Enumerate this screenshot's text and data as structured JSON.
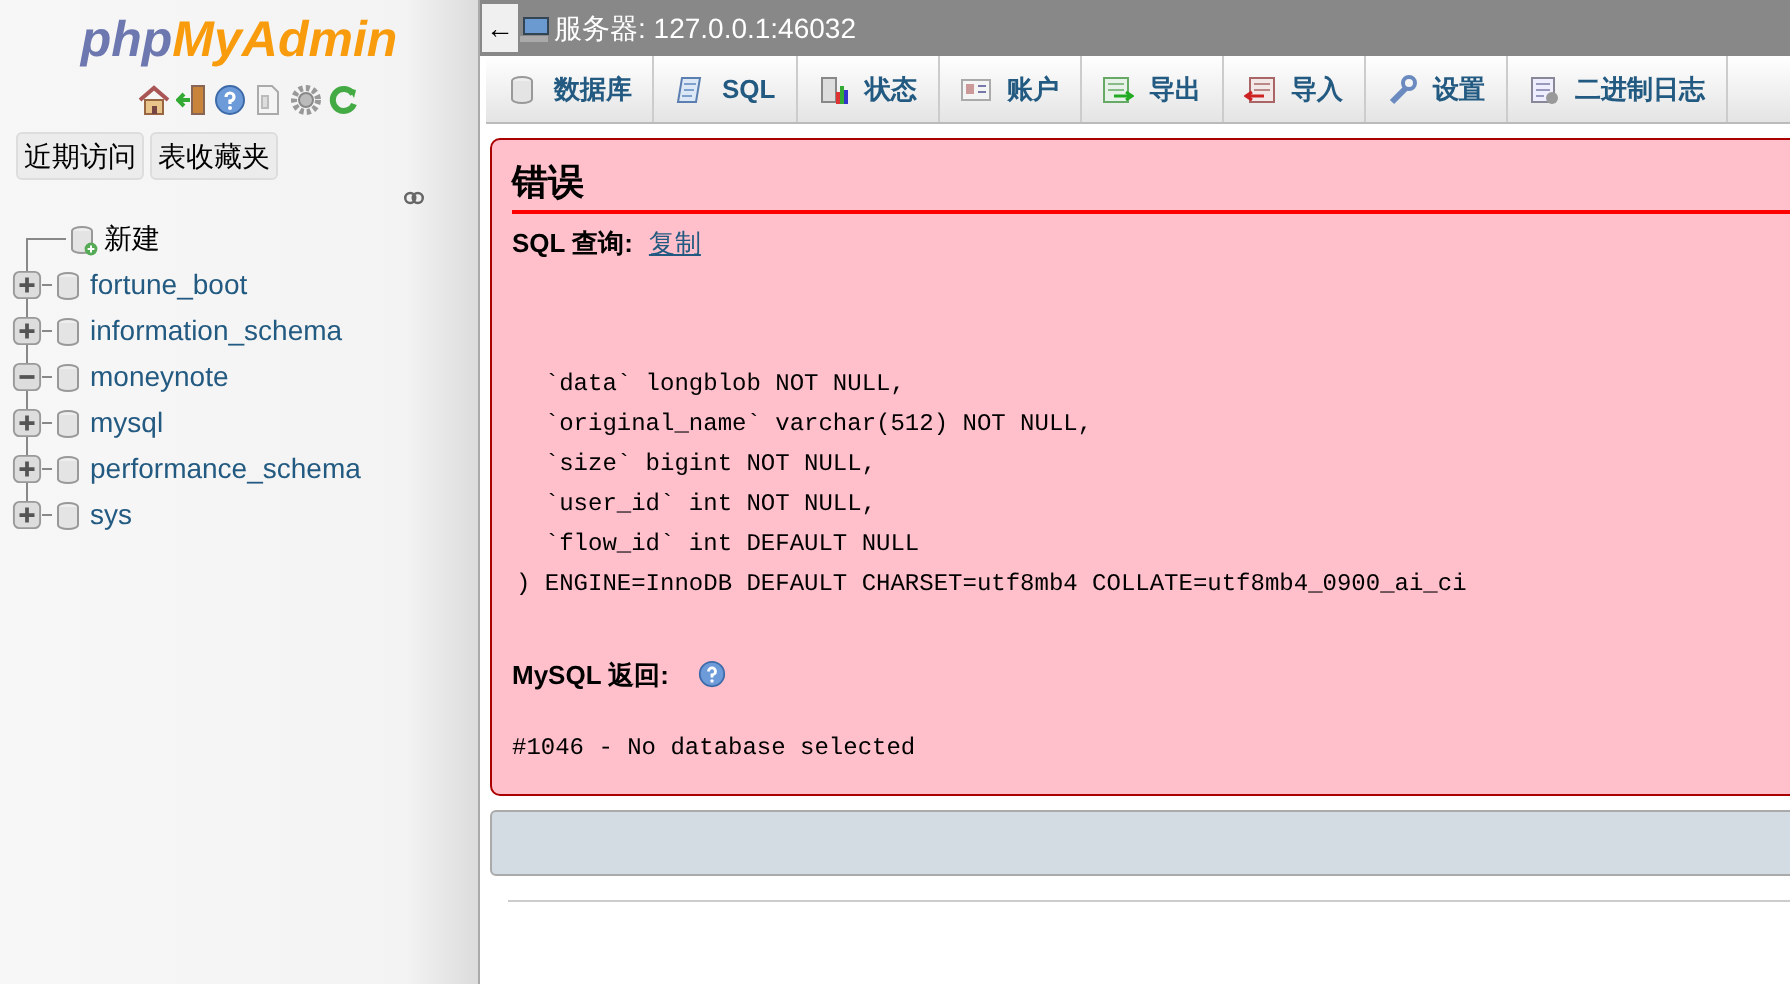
{
  "sidebar": {
    "logo": {
      "part_1": "php",
      "part_2": "MyAdmin"
    },
    "quick_buttons": [
      "近期访问",
      "表收藏夹"
    ],
    "tree": [
      {
        "kind": "new",
        "label": "新建"
      },
      {
        "kind": "db",
        "label": "fortune_boot",
        "expanded": false
      },
      {
        "kind": "db",
        "label": "information_schema",
        "expanded": false
      },
      {
        "kind": "db",
        "label": "moneynote",
        "expanded": true
      },
      {
        "kind": "db",
        "label": "mysql",
        "expanded": false
      },
      {
        "kind": "db",
        "label": "performance_schema",
        "expanded": false
      },
      {
        "kind": "db",
        "label": "sys",
        "expanded": false
      }
    ]
  },
  "top_bar": {
    "back": "←",
    "server": "服务器: 127.0.0.1:46032"
  },
  "tabs": [
    {
      "kind": "db",
      "label": "数据库"
    },
    {
      "kind": "sql",
      "label": "SQL"
    },
    {
      "kind": "status",
      "label": "状态"
    },
    {
      "kind": "account",
      "label": "账户"
    },
    {
      "kind": "export",
      "label": "导出"
    },
    {
      "kind": "import",
      "label": "导入"
    },
    {
      "kind": "settings",
      "label": "设置"
    },
    {
      "kind": "binlog",
      "label": "二进制日志"
    }
  ],
  "error": {
    "title": "错误",
    "query_label": "SQL 查询:",
    "copy_link": "复制",
    "query_lines": [
      "  `data` longblob NOT NULL,",
      "  `original_name` varchar(512) NOT NULL,",
      "  `size` bigint NOT NULL,",
      "  `user_id` int NOT NULL,",
      "  `flow_id` int DEFAULT NULL",
      ") ENGINE=InnoDB DEFAULT CHARSET=utf8mb4 COLLATE=utf8mb4_0900_ai_ci"
    ],
    "response_label": "MySQL 返回:",
    "message": "#1046 - No database selected"
  }
}
